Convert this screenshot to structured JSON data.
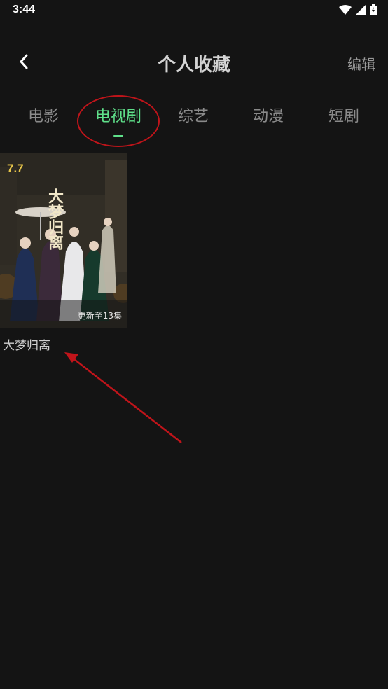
{
  "status_bar": {
    "time": "3:44",
    "icons": [
      "wifi-icon",
      "signal-icon",
      "battery-icon"
    ]
  },
  "header": {
    "title": "个人收藏",
    "edit_label": "编辑",
    "back_icon": "chevron-left-icon"
  },
  "tabs": [
    {
      "label": "电影",
      "active": false
    },
    {
      "label": "电视剧",
      "active": true
    },
    {
      "label": "综艺",
      "active": false
    },
    {
      "label": "动漫",
      "active": false
    },
    {
      "label": "短剧",
      "active": false
    }
  ],
  "favorites": [
    {
      "title": "大梦归离",
      "rating": "7.7",
      "update_status": "更新至13集",
      "poster_title_art": "大梦归离"
    }
  ],
  "colors": {
    "background": "#141414",
    "accent": "#5fe08a",
    "annotation": "#c0141a",
    "rating": "#e8c64a"
  }
}
